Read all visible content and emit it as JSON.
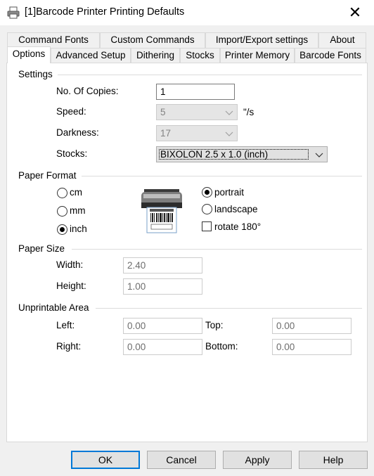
{
  "window": {
    "title": "[1]Barcode Printer Printing Defaults",
    "close_glyph": "✕"
  },
  "tabs_row1": [
    {
      "label": "Command Fonts"
    },
    {
      "label": "Custom Commands"
    },
    {
      "label": "Import/Export settings"
    },
    {
      "label": "About"
    }
  ],
  "tabs_row2": [
    {
      "label": "Options",
      "active": true
    },
    {
      "label": "Advanced Setup"
    },
    {
      "label": "Dithering"
    },
    {
      "label": "Stocks"
    },
    {
      "label": "Printer Memory"
    },
    {
      "label": "Barcode Fonts"
    }
  ],
  "settings": {
    "group": "Settings",
    "copies_label": "No. Of Copies:",
    "copies_value": "1",
    "speed_label": "Speed:",
    "speed_value": "5",
    "speed_unit": "\"/s",
    "darkness_label": "Darkness:",
    "darkness_value": "17",
    "stocks_label": "Stocks:",
    "stocks_value": "BIXOLON 2.5 x 1.0 (inch)"
  },
  "paper_format": {
    "group": "Paper Format",
    "units": [
      {
        "label": "cm",
        "selected": false
      },
      {
        "label": "mm",
        "selected": false
      },
      {
        "label": "inch",
        "selected": true
      }
    ],
    "orientations": [
      {
        "label": "portrait",
        "selected": true
      },
      {
        "label": "landscape",
        "selected": false
      }
    ],
    "rotate_label": "rotate 180°",
    "rotate_checked": false
  },
  "paper_size": {
    "group": "Paper Size",
    "width_label": "Width:",
    "width_value": "2.40",
    "height_label": "Height:",
    "height_value": "1.00"
  },
  "unprintable": {
    "group": "Unprintable Area",
    "left_label": "Left:",
    "left_value": "0.00",
    "top_label": "Top:",
    "top_value": "0.00",
    "right_label": "Right:",
    "right_value": "0.00",
    "bottom_label": "Bottom:",
    "bottom_value": "0.00"
  },
  "buttons": {
    "ok": "OK",
    "cancel": "Cancel",
    "apply": "Apply",
    "help": "Help"
  },
  "colors": {
    "accent": "#0078d7",
    "window_bg": "#f0f0f0",
    "panel_bg": "#ffffff"
  },
  "icons": {
    "title": "printer-icon",
    "dropdown": "chevron-down-icon",
    "preview": "label-printer-icon"
  }
}
